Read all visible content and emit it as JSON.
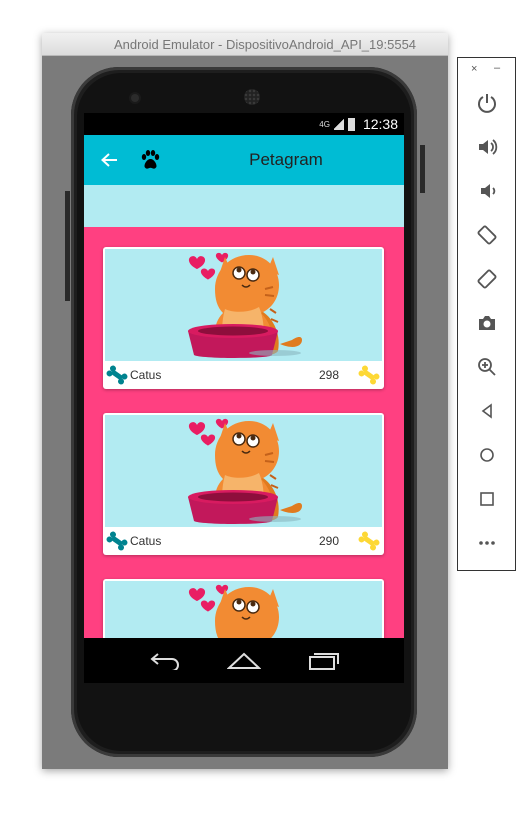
{
  "window": {
    "title": "Android Emulator - DispositivoAndroid_API_19:5554"
  },
  "status_bar": {
    "network": "4G",
    "time": "12:38"
  },
  "toolbar": {
    "title": "Petagram"
  },
  "cards": [
    {
      "name": "Catus",
      "count": "298"
    },
    {
      "name": "Catus",
      "count": "290"
    },
    {
      "name": "",
      "count": ""
    }
  ],
  "side_panel": {
    "close": "×",
    "minimize": "–",
    "buttons": [
      "power-icon",
      "volume-up-icon",
      "volume-down-icon",
      "rotate-left-icon",
      "rotate-right-icon",
      "camera-icon",
      "zoom-icon",
      "back-icon",
      "home-icon",
      "overview-icon",
      "more-icon"
    ]
  },
  "colors": {
    "toolbar": "#00bcd4",
    "subbar": "#b2ebf2",
    "content_bg": "#ff4081",
    "bone_left": "#00838f",
    "bone_right": "#fdd835"
  }
}
